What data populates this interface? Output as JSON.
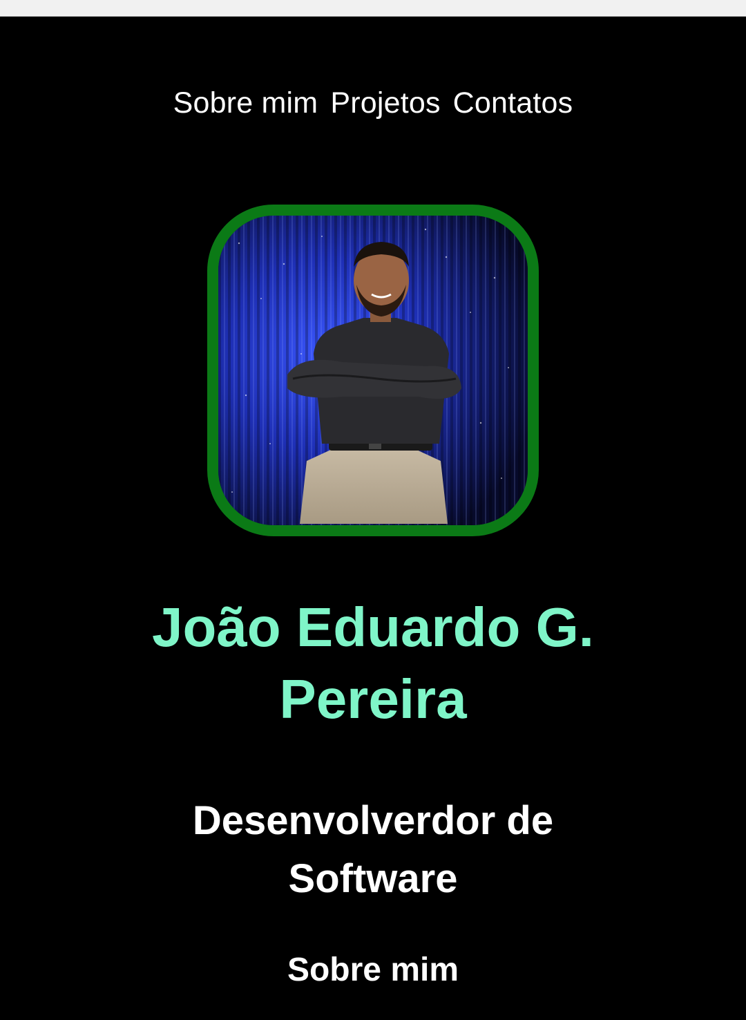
{
  "nav": {
    "items": [
      {
        "label": "Sobre mim"
      },
      {
        "label": "Projetos"
      },
      {
        "label": "Contatos"
      }
    ]
  },
  "profile": {
    "photo_alt": "",
    "name_line1": "João Eduardo G.",
    "name_line2": "Pereira",
    "role_line1": "Desenvolverdor de",
    "role_line2": "Software"
  },
  "about": {
    "heading": "Sobre mim"
  },
  "colors": {
    "background": "#000000",
    "accent_name": "#7ff5c8",
    "photo_border": "#0b7a16",
    "text": "#ffffff"
  }
}
